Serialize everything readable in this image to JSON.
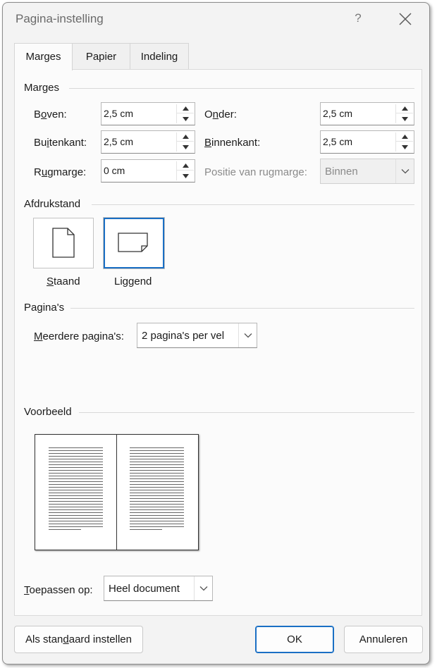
{
  "dialog": {
    "title": "Pagina-instelling",
    "help_label": "?"
  },
  "tabs": [
    {
      "label": "Marges",
      "active": true
    },
    {
      "label": "Papier",
      "active": false
    },
    {
      "label": "Indeling",
      "active": false
    }
  ],
  "margins": {
    "section_title": "Marges",
    "top": {
      "label_pre": "B",
      "label_u": "o",
      "label_post": "ven:",
      "value": "2,5 cm"
    },
    "bottom": {
      "label_pre": "O",
      "label_u": "n",
      "label_post": "der:",
      "value": "2,5 cm"
    },
    "outside": {
      "label_pre": "Bu",
      "label_u": "i",
      "label_post": "tenkant:",
      "value": "2,5 cm"
    },
    "inside": {
      "label_pre": "",
      "label_u": "B",
      "label_post": "innenkant:",
      "value": "2,5 cm"
    },
    "gutter": {
      "label_pre": "R",
      "label_u": "u",
      "label_post": "gmarge:",
      "value": "0 cm"
    },
    "gutter_position": {
      "label": "Positie van rugmarge:",
      "value": "Binnen"
    }
  },
  "orientation": {
    "section_title": "Afdrukstand",
    "portrait": {
      "label_pre": "",
      "label_u": "S",
      "label_post": "taand"
    },
    "landscape": {
      "label_pre": "Lig",
      "label_u": "g",
      "label_post": "end"
    },
    "selected": "landscape"
  },
  "pages": {
    "section_title": "Pagina's",
    "multiple_label_pre": "",
    "multiple_label_u": "M",
    "multiple_label_post": "eerdere pagina's:",
    "multiple_value": "2 pagina's per vel"
  },
  "preview": {
    "section_title": "Voorbeeld"
  },
  "apply": {
    "label_pre": "",
    "label_u": "T",
    "label_post": "oepassen op:",
    "value": "Heel document"
  },
  "buttons": {
    "default_pre": "Als stan",
    "default_u": "d",
    "default_post": "aard instellen",
    "ok": "OK",
    "cancel": "Annuleren"
  },
  "colors": {
    "accent": "#1a6fc4",
    "background": "#f3f3f3"
  }
}
